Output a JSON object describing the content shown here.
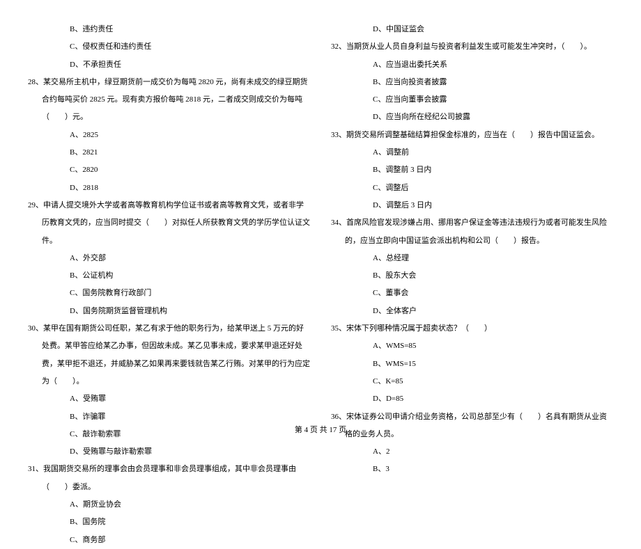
{
  "leftColumn": {
    "q27_options": {
      "b": "B、违约责任",
      "c": "C、侵权责任和违约责任",
      "d": "D、不承担责任"
    },
    "q28": {
      "text": "28、某交易所主机中，绿豆期货前一成交价为每吨 2820 元，尚有未成交的绿豆期货合约每吨买价 2825 元。现有卖方报价每吨 2818 元，二者成交则成交价为每吨（　　）元。",
      "a": "A、2825",
      "b": "B、2821",
      "c": "C、2820",
      "d": "D、2818"
    },
    "q29": {
      "text": "29、申请人提交境外大学或者高等教育机构学位证书或者高等教育文凭，或者非学历教育文凭的，应当同时提交（　　）对拟任人所获教育文凭的学历学位认证文件。",
      "a": "A、外交部",
      "b": "B、公证机构",
      "c": "C、国务院教育行政部门",
      "d": "D、国务院期货监督管理机构"
    },
    "q30": {
      "text": "30、某甲在国有期货公司任职，某乙有求于他的职务行为，给某甲送上 5 万元的好处费。某甲答应给某乙办事，但因故未成。某乙见事未成，要求某甲退还好处费，某甲拒不退还，并威胁某乙如果再来要钱就告某乙行贿。对某甲的行为应定为（　　）。",
      "a": "A、受贿罪",
      "b": "B、诈骗罪",
      "c": "C、敲诈勒索罪",
      "d": "D、受贿罪与敲诈勒索罪"
    },
    "q31": {
      "text": "31、我国期货交易所的理事会由会员理事和非会员理事组成，其中非会员理事由（　　）委派。",
      "a": "A、期货业协会",
      "b": "B、国务院",
      "c": "C、商务部"
    }
  },
  "rightColumn": {
    "q31_options": {
      "d": "D、中国证监会"
    },
    "q32": {
      "text": "32、当期货从业人员自身利益与投资者利益发生或可能发生冲突时，（　　）。",
      "a": "A、应当退出委托关系",
      "b": "B、应当向投资者披露",
      "c": "C、应当向董事会披露",
      "d": "D、应当向所在经纪公司披露"
    },
    "q33": {
      "text": "33、期货交易所调整基础结算担保金标准的，应当在（　　）报告中国证监会。",
      "a": "A、调整前",
      "b": "B、调整前 3 日内",
      "c": "C、调整后",
      "d": "D、调整后 3 日内"
    },
    "q34": {
      "text": "34、首席风险官发现涉嫌占用、挪用客户保证金等违法违规行为或者可能发生风险的，应当立即向中国证监会派出机构和公司（　　）报告。",
      "a": "A、总经理",
      "b": "B、股东大会",
      "c": "C、董事会",
      "d": "D、全体客户"
    },
    "q35": {
      "text": "35、宋体下列哪种情况属于超卖状态？（　　）",
      "a": "A、WMS=85",
      "b": "B、WMS=15",
      "c": "C、K=85",
      "d": "D、D=85"
    },
    "q36": {
      "text": "36、宋体证券公司申请介绍业务资格，公司总部至少有（　　）名具有期货从业资格的业务人员。",
      "a": "A、2",
      "b": "B、3"
    }
  },
  "footer": "第 4 页 共 17 页"
}
